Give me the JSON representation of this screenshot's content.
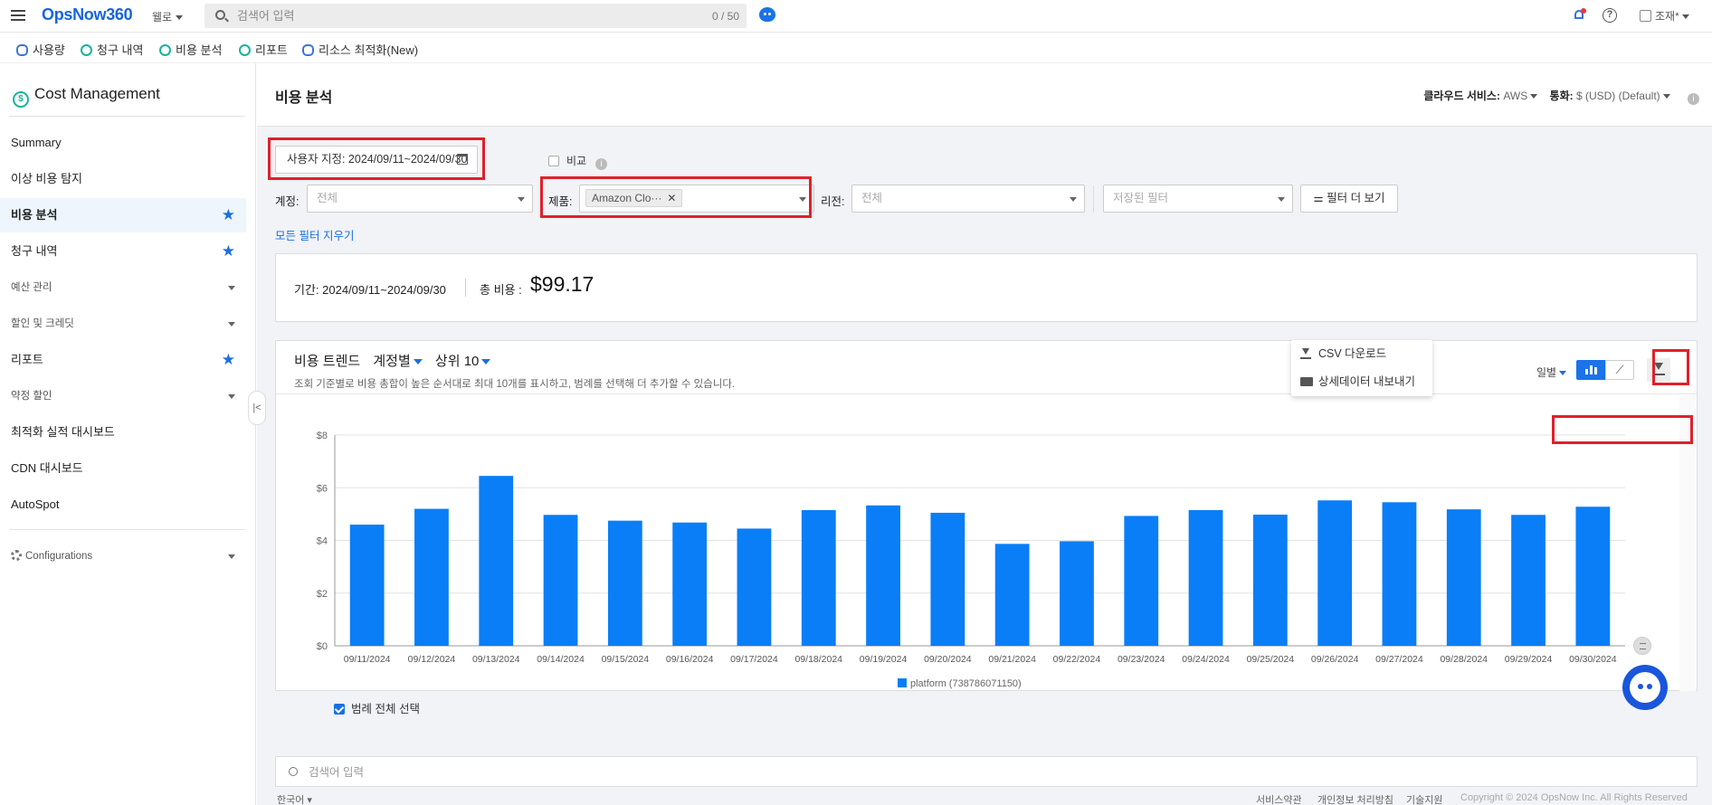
{
  "header": {
    "logo": "OpsNow360",
    "workspace": "웰로",
    "search_placeholder": "검색어 입력",
    "search_count": "0 / 50",
    "user": "조재*"
  },
  "subnav": {
    "items": [
      {
        "label": "사용량",
        "icon": "database-icon"
      },
      {
        "label": "청구 내역",
        "icon": "dollar-coin-icon"
      },
      {
        "label": "비용 분석",
        "icon": "dollar-coin-icon"
      },
      {
        "label": "리포트",
        "icon": "dollar-coin-icon"
      },
      {
        "label": "리소스 최적화(New)",
        "icon": "database-icon"
      }
    ]
  },
  "sidebar": {
    "title": "Cost Management",
    "items": [
      {
        "label": "Summary"
      },
      {
        "label": "이상 비용 탐지"
      },
      {
        "label": "비용 분석",
        "starred": true,
        "active": true
      },
      {
        "label": "청구 내역",
        "starred": true
      },
      {
        "label": "예산 관리",
        "expandable": true
      },
      {
        "label": "할인 및 크레딧",
        "expandable": true
      },
      {
        "label": "리포트",
        "starred": true
      },
      {
        "label": "약정 할인",
        "expandable": true
      },
      {
        "label": "최적화 실적 대시보드"
      },
      {
        "label": "CDN 대시보드"
      },
      {
        "label": "AutoSpot"
      }
    ],
    "configurations": "Configurations"
  },
  "page": {
    "title": "비용 분석",
    "cloud_label": "클라우드 서비스:",
    "cloud_value": "AWS",
    "currency_label": "통화:",
    "currency_value": "$ (USD) (Default)"
  },
  "filters": {
    "date_range": "사용자 지정: 2024/09/11~2024/09/30",
    "compare_label": "비교",
    "account_label": "계정:",
    "account_placeholder": "전체",
    "product_label": "제품:",
    "product_chip": "Amazon Clo···",
    "region_label": "리전:",
    "region_placeholder": "전체",
    "saved_filter_placeholder": "저장된 필터",
    "more_filters": "필터 더 보기",
    "clear_all": "모든 필터 지우기"
  },
  "summary": {
    "period": "기간: 2024/09/11~2024/09/30",
    "total_label": "총 비용 :",
    "total_value": "$99.17"
  },
  "trend": {
    "title": "비용 트렌드",
    "group_by": "계정별",
    "top_n": "상위 10",
    "description": "조회 기준별로 비용 총합이 높은 순서대로 최대 10개를 표시하고, 범례를 선택해 더 추가할 수 있습니다.",
    "period": "일별",
    "download_menu": [
      "CSV 다운로드",
      "상세데이터 내보내기"
    ],
    "select_all_legend": "범례 전체 선택"
  },
  "chart_data": {
    "type": "bar",
    "categories": [
      "09/11/2024",
      "09/12/2024",
      "09/13/2024",
      "09/14/2024",
      "09/15/2024",
      "09/16/2024",
      "09/17/2024",
      "09/18/2024",
      "09/19/2024",
      "09/20/2024",
      "09/21/2024",
      "09/22/2024",
      "09/23/2024",
      "09/24/2024",
      "09/25/2024",
      "09/26/2024",
      "09/27/2024",
      "09/28/2024",
      "09/29/2024",
      "09/30/2024"
    ],
    "series": [
      {
        "name": "platform (738786071150)",
        "values": [
          4.6,
          5.2,
          6.45,
          4.97,
          4.75,
          4.68,
          4.45,
          5.15,
          5.33,
          5.05,
          3.87,
          3.97,
          4.93,
          5.15,
          4.98,
          5.52,
          5.45,
          5.18,
          4.97,
          5.28
        ]
      }
    ],
    "yticks": [
      "$0",
      "$2",
      "$4",
      "$6",
      "$8"
    ],
    "ylim": [
      0,
      8
    ],
    "color": "#0a7ef7"
  },
  "table": {
    "search_placeholder": "검색어 입력"
  },
  "footer": {
    "language": "한국어",
    "links": [
      "서비스약관",
      "개인정보 처리방침",
      "기술지원"
    ],
    "copyright": "Copyright © 2024 OpsNow Inc. All Rights Reserved"
  },
  "colors": {
    "accent": "#1a6fe0",
    "highlight": "#e0202a",
    "bar": "#0a7ef7"
  }
}
